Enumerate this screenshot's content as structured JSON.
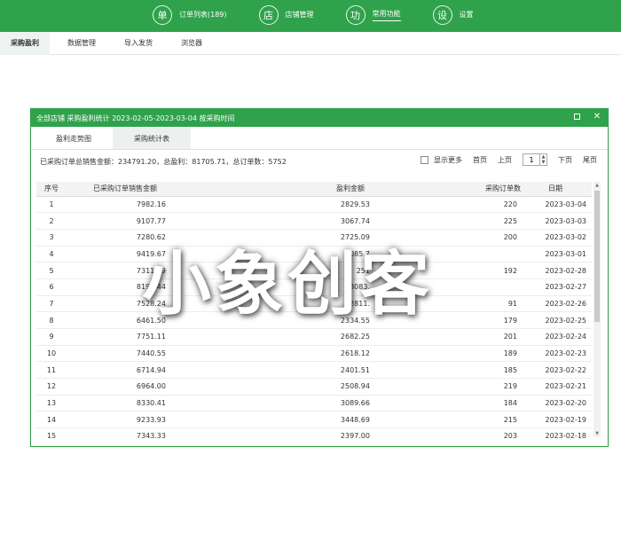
{
  "topnav": [
    {
      "icon": "单",
      "label": "订单列表(189)",
      "active": false
    },
    {
      "icon": "店",
      "label": "店铺管理",
      "active": false
    },
    {
      "icon": "功",
      "label": "常用功能",
      "active": true
    },
    {
      "icon": "设",
      "label": "设置",
      "active": false
    }
  ],
  "subtabs": [
    "采购盈利",
    "数据管理",
    "导入发货",
    "浏览器"
  ],
  "dialog": {
    "title": "全部店铺 采购盈利统计 2023-02-05-2023-03-04 按采购时间",
    "tabs": [
      "盈利走势图",
      "采购统计表"
    ],
    "summary": "已采购订单总销售金额：234791.20，总盈利：81705.71，总订单数：5752",
    "pager": {
      "show_more": "显示更多",
      "first": "首页",
      "prev": "上页",
      "page": "1",
      "next": "下页",
      "last": "尾页"
    },
    "columns": [
      "序号",
      "已采购订单销售金额",
      "盈利金额",
      "采购订单数",
      "日期"
    ],
    "rows": [
      [
        "1",
        "7982.16",
        "2829.53",
        "220",
        "2023-03-04"
      ],
      [
        "2",
        "9107.77",
        "3067.74",
        "225",
        "2023-03-03"
      ],
      [
        "3",
        "7280.62",
        "2725.09",
        "200",
        "2023-03-02"
      ],
      [
        "4",
        "9419.67",
        "3085.7",
        "",
        "2023-03-01"
      ],
      [
        "5",
        "7311.99",
        "251",
        "192",
        "2023-02-28"
      ],
      [
        "6",
        "8192.44",
        "3083.",
        "",
        "2023-02-27"
      ],
      [
        "7",
        "7528.24",
        "2811.",
        "91",
        "2023-02-26"
      ],
      [
        "8",
        "6461.50",
        "2334.55",
        "179",
        "2023-02-25"
      ],
      [
        "9",
        "7751.11",
        "2682.25",
        "201",
        "2023-02-24"
      ],
      [
        "10",
        "7440.55",
        "2618.12",
        "189",
        "2023-02-23"
      ],
      [
        "11",
        "6714.94",
        "2401.51",
        "185",
        "2023-02-22"
      ],
      [
        "12",
        "6964.00",
        "2508.94",
        "219",
        "2023-02-21"
      ],
      [
        "13",
        "8330.41",
        "3089.66",
        "184",
        "2023-02-20"
      ],
      [
        "14",
        "9233.93",
        "3448.69",
        "215",
        "2023-02-19"
      ],
      [
        "15",
        "7343.33",
        "2397.00",
        "203",
        "2023-02-18"
      ]
    ]
  },
  "watermark": "小象创客",
  "colors": {
    "accent": "#2fa24b"
  }
}
